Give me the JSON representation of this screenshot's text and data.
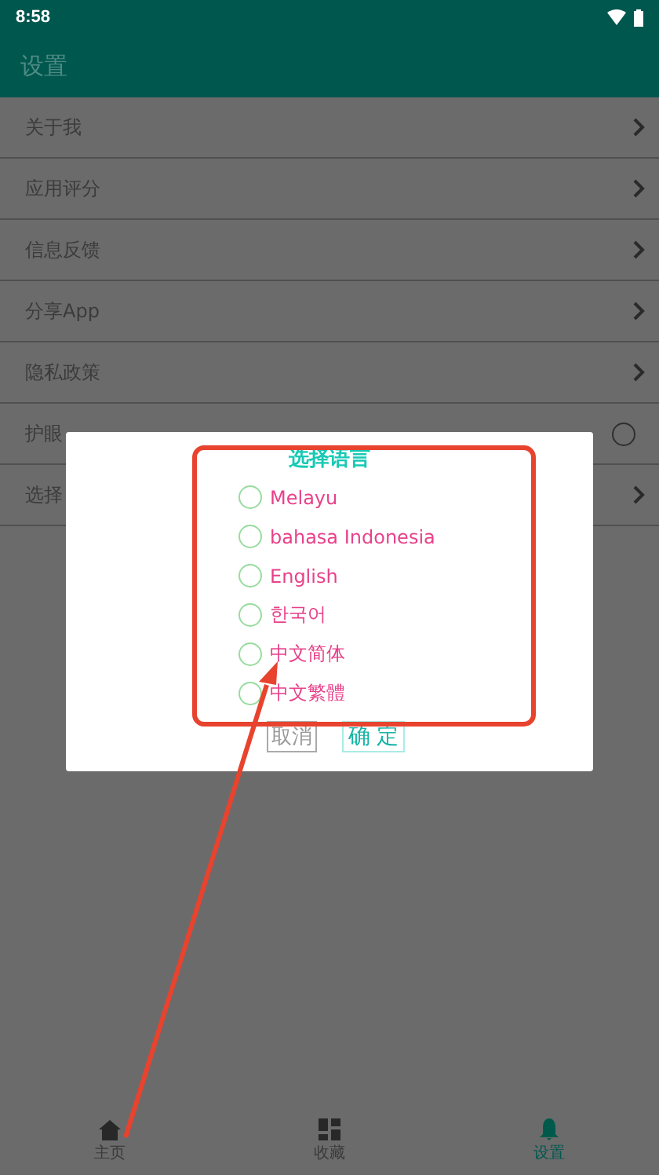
{
  "status_bar": {
    "time": "8:58"
  },
  "app_bar": {
    "title": "设置"
  },
  "settings": [
    {
      "label": "关于我",
      "kind": "link"
    },
    {
      "label": "应用评分",
      "kind": "link"
    },
    {
      "label": "信息反馈",
      "kind": "link"
    },
    {
      "label": "分享App",
      "kind": "link"
    },
    {
      "label": "隐私政策",
      "kind": "link"
    },
    {
      "label": "护眼",
      "kind": "toggle",
      "on": false
    },
    {
      "label": "选择",
      "kind": "link"
    }
  ],
  "dialog": {
    "title": "选择语言",
    "options": [
      {
        "label": "Melayu",
        "selected": false
      },
      {
        "label": "bahasa Indonesia",
        "selected": false
      },
      {
        "label": "English",
        "selected": false
      },
      {
        "label": "한국어",
        "selected": false
      },
      {
        "label": "中文简体",
        "selected": false
      },
      {
        "label": "中文繁體",
        "selected": false
      }
    ],
    "cancel": "取消",
    "confirm": "确 定"
  },
  "bottom_nav": [
    {
      "label": "主页",
      "selected": false
    },
    {
      "label": "收藏",
      "selected": false
    },
    {
      "label": "设置",
      "selected": true
    }
  ]
}
